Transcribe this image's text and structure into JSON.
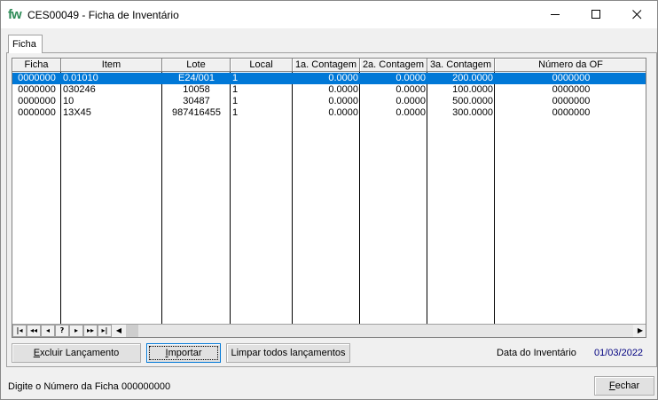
{
  "window": {
    "logo_text": "fw",
    "title": "CES00049 - Ficha de Inventário",
    "min_icon": "minimize-icon",
    "max_icon": "maximize-icon",
    "close_icon": "close-icon"
  },
  "tabs": [
    {
      "label": "Ficha"
    }
  ],
  "grid": {
    "columns": [
      "Ficha",
      "Item",
      "Lote",
      "Local",
      "1a. Contagem",
      "2a. Contagem",
      "3a. Contagem",
      "Número da OF"
    ],
    "rows": [
      [
        "0000000",
        "0.01010",
        "E24/001",
        "1",
        "0.0000",
        "0.0000",
        "200.0000",
        "0000000"
      ],
      [
        "0000000",
        "030246",
        "10058",
        "1",
        "0.0000",
        "0.0000",
        "100.0000",
        "0000000"
      ],
      [
        "0000000",
        "10",
        "30487",
        "1",
        "0.0000",
        "0.0000",
        "500.0000",
        "0000000"
      ],
      [
        "0000000",
        "13X45",
        "987416455",
        "1",
        "0.0000",
        "0.0000",
        "300.0000",
        "0000000"
      ]
    ],
    "selected_row": 0,
    "nav_buttons": [
      "|◂",
      "◂◂",
      "◂",
      "?",
      "▸",
      "▸▸",
      "▸|"
    ],
    "accent_color": "#0078d7"
  },
  "buttons": {
    "excluir_pre": "",
    "excluir_u": "E",
    "excluir_post": "xcluir Lançamento",
    "importar_pre": "",
    "importar_u": "I",
    "importar_post": "mportar",
    "limpar": "Limpar todos lançamentos",
    "fechar_pre": "",
    "fechar_u": "F",
    "fechar_post": "echar"
  },
  "inventory": {
    "date_label": "Data do Inventário",
    "date_value": "01/03/2022"
  },
  "footer": {
    "prompt_label": "Digite o Número da Ficha",
    "prompt_value": "000000000"
  }
}
